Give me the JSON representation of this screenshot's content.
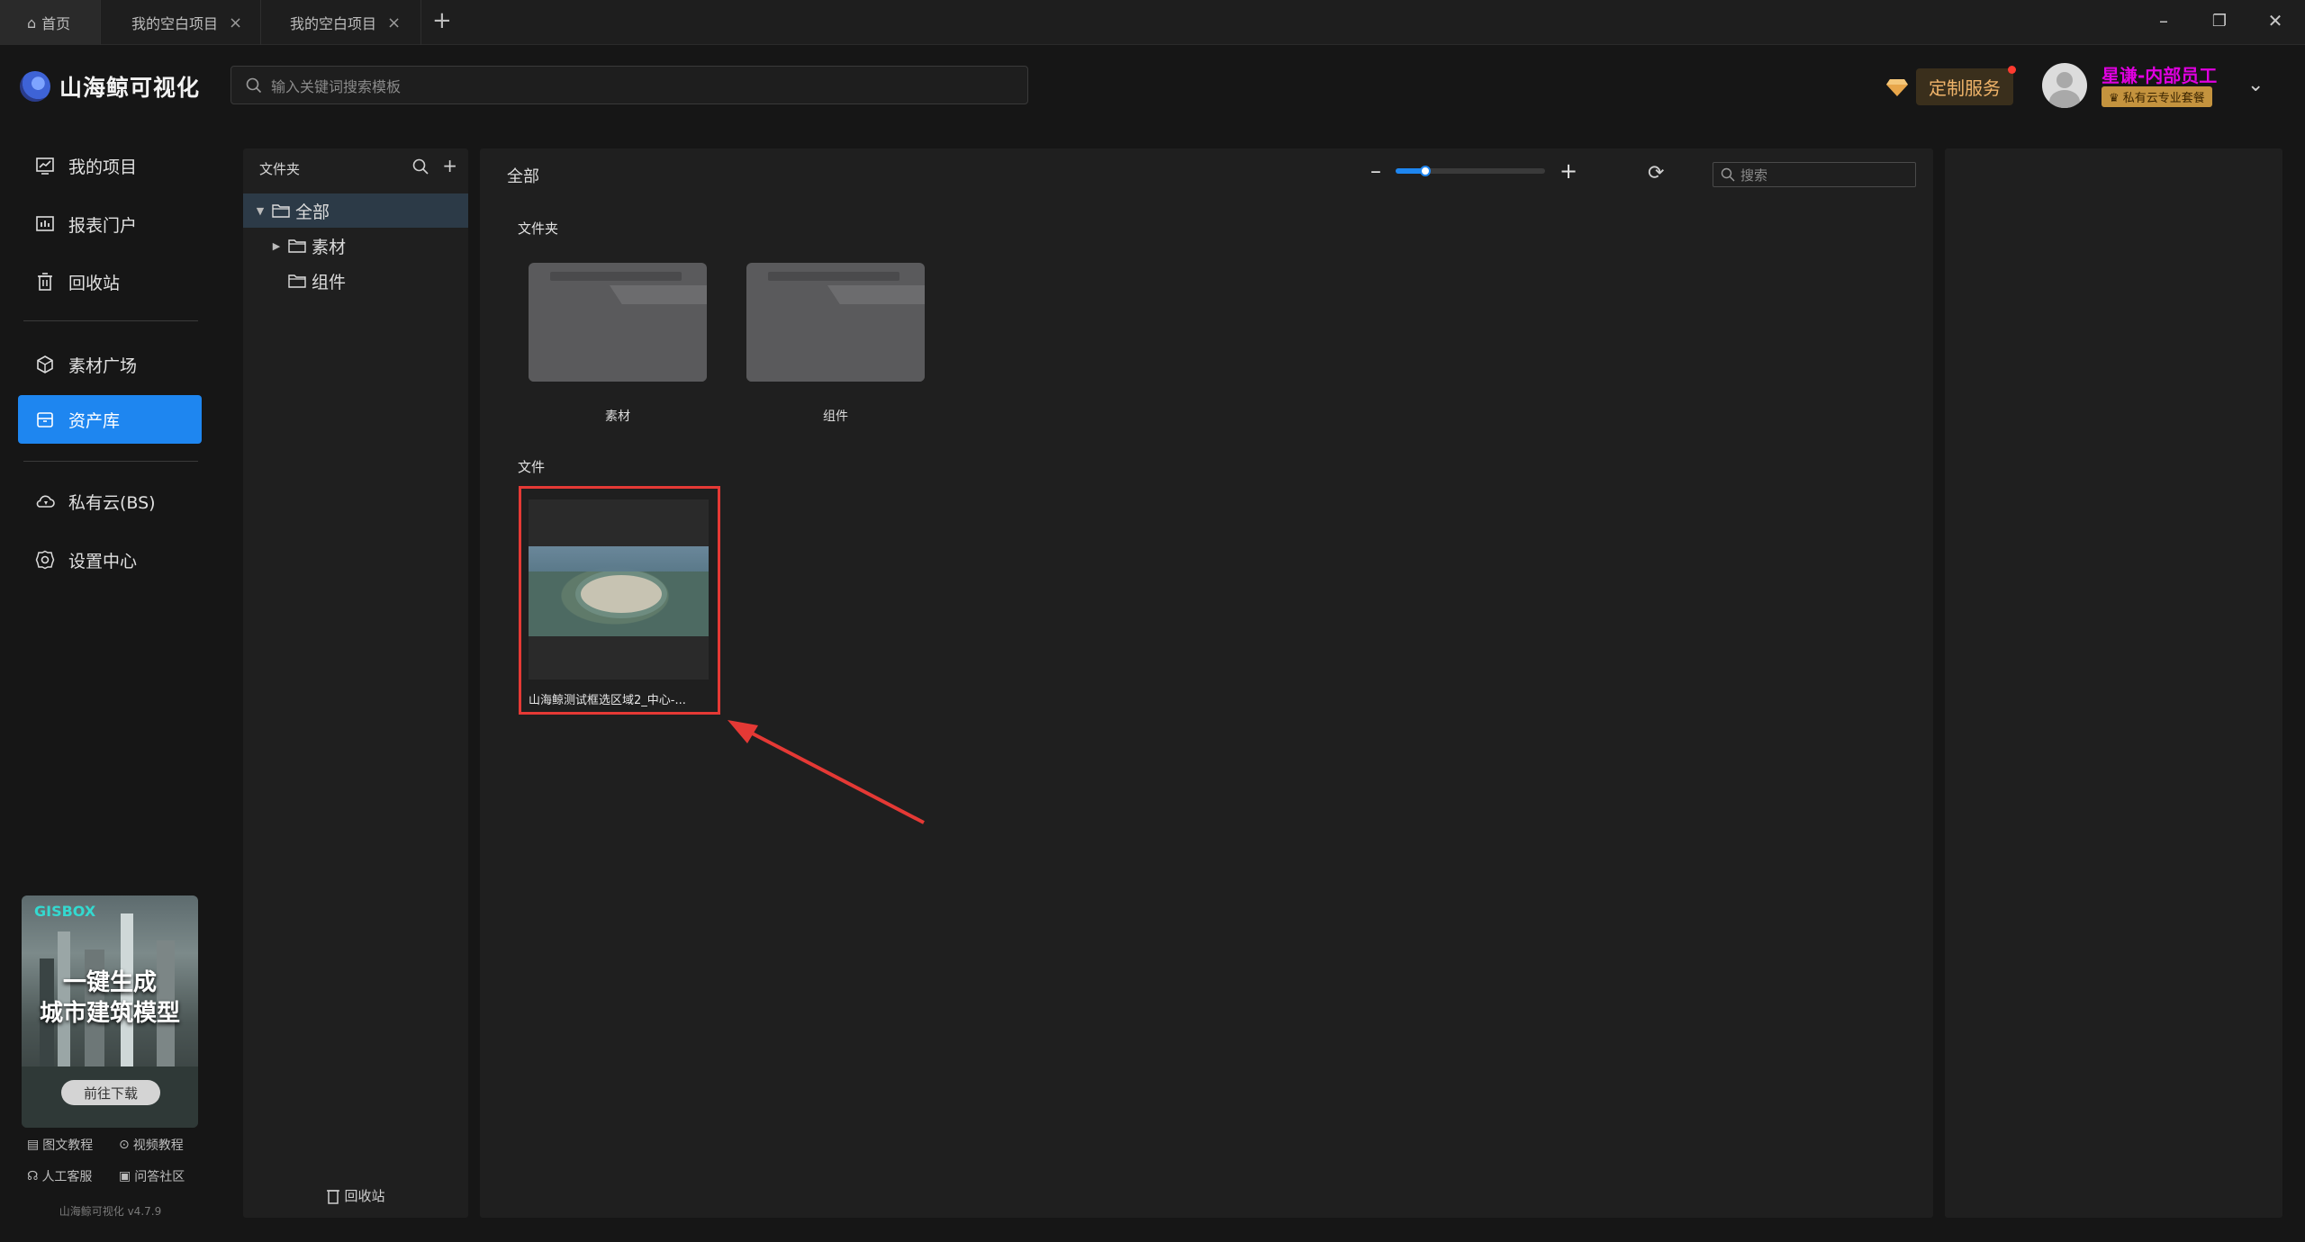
{
  "tabs": [
    {
      "label": "首页",
      "icon": "home-icon"
    },
    {
      "label": "我的空白项目"
    },
    {
      "label": "我的空白项目"
    }
  ],
  "window_controls": {
    "minimize": "–",
    "restore": "❐",
    "close": "✕"
  },
  "app": {
    "name": "山海鲸可视化",
    "version": "山海鲸可视化 v4.7.9"
  },
  "search": {
    "placeholder": "输入关键词搜索模板"
  },
  "custom_service": {
    "label": "定制服务"
  },
  "user": {
    "name": "星谦-内部员工",
    "badge": "♛ 私有云专业套餐"
  },
  "sidebar": {
    "items": [
      {
        "label": "我的项目",
        "icon": "project-chart-icon"
      },
      {
        "label": "报表门户",
        "icon": "report-portal-icon"
      },
      {
        "label": "回收站",
        "icon": "trash-icon"
      },
      {
        "label": "素材广场",
        "icon": "material-cube-icon"
      },
      {
        "label": "资产库",
        "icon": "asset-box-icon",
        "active": true
      },
      {
        "label": "私有云(BS)",
        "icon": "cloud-icon"
      },
      {
        "label": "设置中心",
        "icon": "gear-icon"
      }
    ],
    "promo": {
      "brand": "GISBOX",
      "line1": "一键生成",
      "line2": "城市建筑模型",
      "button": "前往下载"
    },
    "links": [
      "图文教程",
      "视频教程",
      "人工客服",
      "问答社区"
    ]
  },
  "tree": {
    "header": "文件夹",
    "nodes": [
      {
        "label": "全部",
        "selected": true
      },
      {
        "label": "素材"
      },
      {
        "label": "组件"
      }
    ],
    "trash": "回收站"
  },
  "main": {
    "breadcrumb": "全部",
    "zoom_level": 0.2,
    "search_placeholder": "搜索",
    "folders_title": "文件夹",
    "folders": [
      "素材",
      "组件"
    ],
    "files_title": "文件",
    "files": [
      {
        "name": "山海鲸测试框选区域2_中心-..."
      }
    ]
  },
  "colors": {
    "accent": "#1e86f0",
    "highlight_box": "#e53935",
    "user_name": "#e000e0",
    "custom_service": "#f0b46a"
  }
}
